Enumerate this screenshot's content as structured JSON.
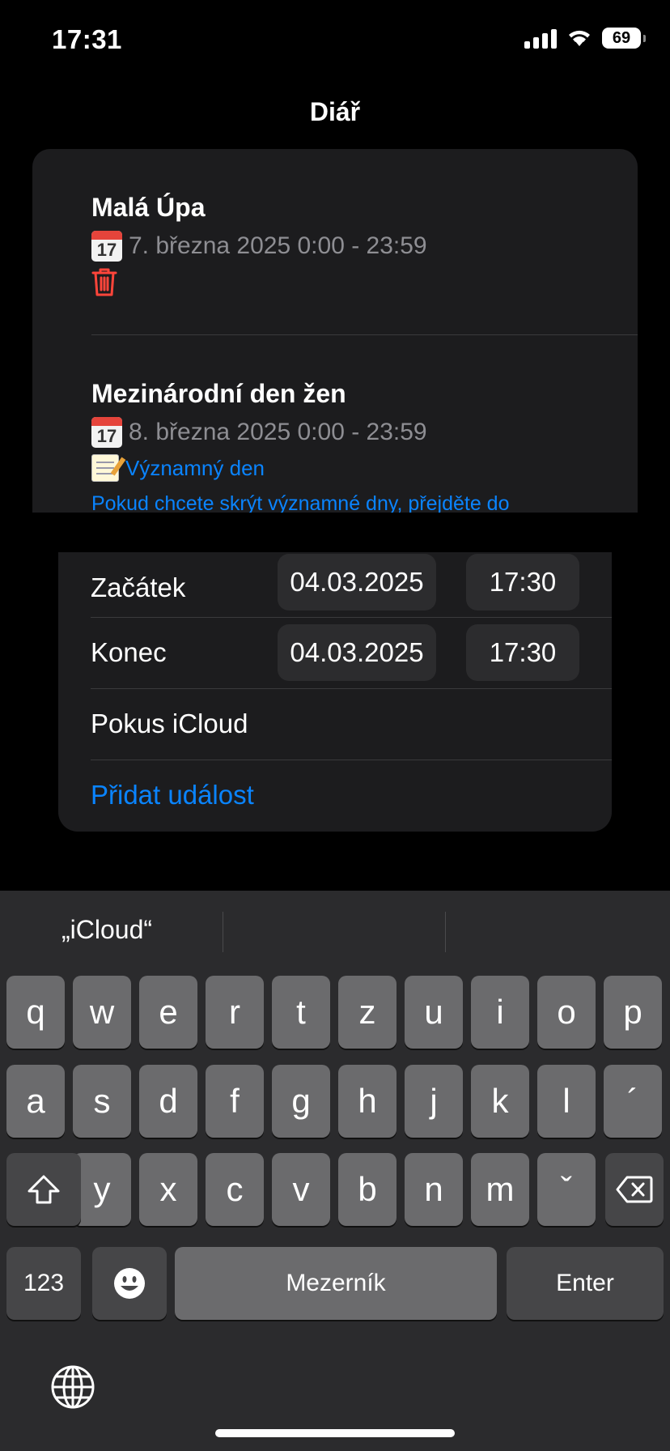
{
  "status_bar": {
    "time": "17:31",
    "battery": "69"
  },
  "nav": {
    "title": "Diář"
  },
  "events": [
    {
      "title": "Malá Úpa",
      "date": "7. března 2025 0:00 - 23:59",
      "calendar_icon_text": "17"
    },
    {
      "title": "Mezinárodní den žen",
      "date": "8. března 2025 0:00 - 23:59",
      "calendar_icon_text": "17",
      "note_label": "Významný den",
      "note_text": "Pokud chcete skrýt významné dny, přejděte do"
    }
  ],
  "form": {
    "start_label": "Začátek",
    "start_date": "04.03.2025",
    "start_time": "17:30",
    "end_label": "Konec",
    "end_date": "04.03.2025",
    "end_time": "17:30",
    "title_value": "Pokus iCloud",
    "add_button": "Přidat událost"
  },
  "keyboard": {
    "suggestion": "„iCloud“",
    "row1": [
      "q",
      "w",
      "e",
      "r",
      "t",
      "z",
      "u",
      "i",
      "o",
      "p"
    ],
    "row2": [
      "a",
      "s",
      "d",
      "f",
      "g",
      "h",
      "j",
      "k",
      "l",
      "´"
    ],
    "row3": [
      "y",
      "x",
      "c",
      "v",
      "b",
      "n",
      "m",
      "ˇ"
    ],
    "numbers_key": "123",
    "space_key": "Mezerník",
    "enter_key": "Enter"
  },
  "colors": {
    "accent": "#0a84ff",
    "delete": "#ff453a",
    "card": "#1c1c1e",
    "keyboard_bg": "#2b2b2d"
  }
}
